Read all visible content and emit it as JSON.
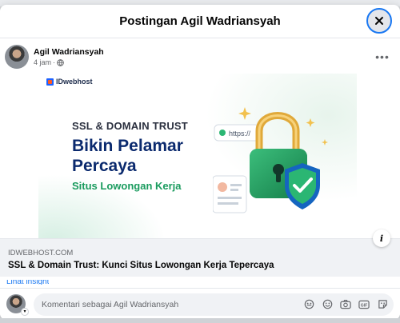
{
  "dialog": {
    "title": "Postingan Agil Wadriansyah",
    "close_icon": "close-icon"
  },
  "post": {
    "author": "Agil Wadriansyah",
    "time": "4 jam",
    "separator": "·",
    "audience_icon": "globe-icon",
    "more_label": "•••"
  },
  "link_preview": {
    "image": {
      "brand": "IDwebhost",
      "kicker": "SSL & DOMAIN TRUST",
      "headline": "Bikin Pelamar Percaya",
      "subheadline": "Situs Lowongan Kerja",
      "address_bar": "https://"
    },
    "domain": "IDWEBHOST.COM",
    "title": "SSL & Domain Trust: Kunci Situs Lowongan Kerja Tepercaya",
    "info_label": "i"
  },
  "partial_link": "Lihat insight",
  "composer": {
    "placeholder": "Komentari sebagai Agil Wadriansyah",
    "icons": [
      "avatar-sticker-icon",
      "emoji-icon",
      "camera-icon",
      "gif-icon",
      "sticker-icon"
    ]
  },
  "colors": {
    "accent": "#1877f2",
    "text": "#050505",
    "secondary_text": "#65676b",
    "panel": "#f0f2f5"
  }
}
